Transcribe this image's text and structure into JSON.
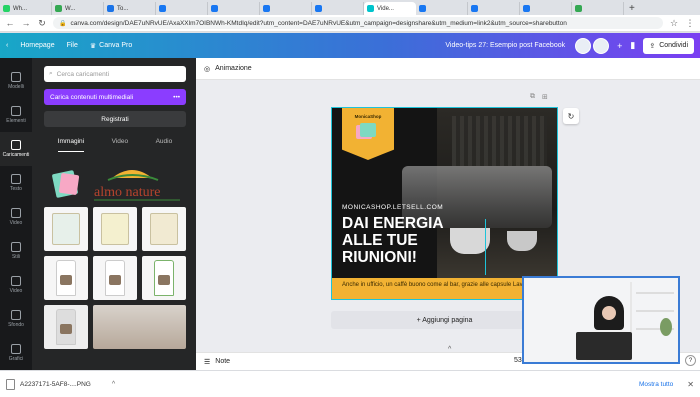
{
  "browser": {
    "tabs": [
      {
        "label": "Wh...",
        "favicon_color": "#25d366"
      },
      {
        "label": "W...",
        "favicon_color": "#34a853"
      },
      {
        "label": "To...",
        "favicon_color": "#1a73e8"
      },
      {
        "label": "",
        "favicon_color": "#1877f2"
      },
      {
        "label": "",
        "favicon_color": "#1877f2"
      },
      {
        "label": "",
        "favicon_color": "#1877f2"
      },
      {
        "label": "",
        "favicon_color": "#1877f2"
      },
      {
        "label": "Vide...",
        "favicon_color": "#00c4cc",
        "active": true
      },
      {
        "label": "",
        "favicon_color": "#1877f2"
      },
      {
        "label": "",
        "favicon_color": "#1877f2"
      },
      {
        "label": "",
        "favicon_color": "#1877f2"
      },
      {
        "label": "",
        "favicon_color": "#34a853"
      }
    ],
    "new_tab_glyph": "+",
    "nav": {
      "back": "←",
      "forward": "→",
      "reload": "↻"
    },
    "url": "canva.com/design/DAE7uNRvUE/AxaXXlm7OIBNWh-KMtdIq/edit?utm_content=DAE7uNRvUE&utm_campaign=designshare&utm_medium=link2&utm_source=sharebutton",
    "right_icons": [
      "☆",
      "⋮"
    ]
  },
  "canva_bar": {
    "back_glyph": "‹",
    "home": "Homepage",
    "file": "File",
    "pro": "Canva Pro",
    "title": "Video-tips 27: Esempio post Facebook",
    "share": "Condividi",
    "icons": {
      "plus": "+",
      "chart": "▮"
    },
    "share_icon": "⇪"
  },
  "rail": [
    {
      "label": "Modelli",
      "active": false
    },
    {
      "label": "Elementi",
      "active": false
    },
    {
      "label": "Caricamenti",
      "active": true
    },
    {
      "label": "Testo",
      "active": false
    },
    {
      "label": "Video",
      "active": false
    },
    {
      "label": "Stili",
      "active": false
    },
    {
      "label": "Video",
      "active": false
    },
    {
      "label": "Sfondo",
      "active": false
    },
    {
      "label": "Grafici",
      "active": false
    }
  ],
  "panel": {
    "search_placeholder": "Cerca caricamenti",
    "upload": "Carica contenuti multimediali",
    "more": "•••",
    "record": "Registrati",
    "tabs": [
      "Immagini",
      "Video",
      "Audio"
    ],
    "active_tab": 0,
    "logo_text": "almo nature",
    "collapse": "‹"
  },
  "toolbar": {
    "animation": "Animazione"
  },
  "design": {
    "badge_brand": "MonicaShop",
    "url": "MONICASHOP.LETSELL.COM",
    "headline": "DAI ENERGIA ALLE TUE RIUNIONI!",
    "footer": "Anche in ufficio, un caffè buono come al bar, grazie alle capsule Lavazza",
    "page_icons": [
      "⧉",
      "⊞"
    ],
    "refresh": "↻"
  },
  "add_page": "+ Aggiungi pagina",
  "statusbar": {
    "notes": "Note",
    "zoom": "53",
    "help": "?",
    "caret": "^"
  },
  "downloads": {
    "file": "A2237171-5AF8-....PNG",
    "chevron": "^",
    "show_all": "Mostra tutto",
    "close": "✕"
  }
}
